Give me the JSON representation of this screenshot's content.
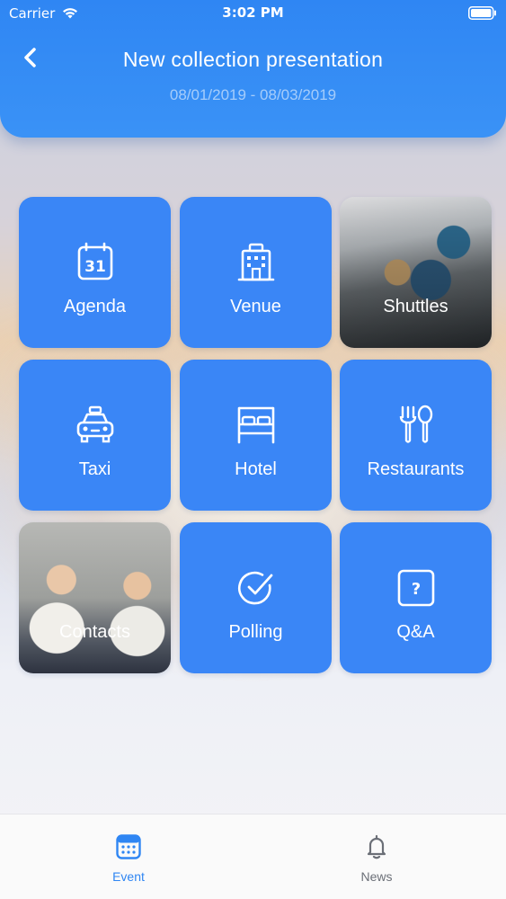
{
  "status_bar": {
    "carrier": "Carrier",
    "time": "3:02 PM"
  },
  "header": {
    "title": "New collection presentation",
    "dates": "08/01/2019 - 08/03/2019"
  },
  "calendar_day": "31",
  "qa_glyph": "?",
  "tiles": [
    {
      "label": "Agenda",
      "icon": "calendar-icon"
    },
    {
      "label": "Venue",
      "icon": "building-icon"
    },
    {
      "label": "Shuttles",
      "icon": "bus-interior-photo"
    },
    {
      "label": "Taxi",
      "icon": "taxi-icon"
    },
    {
      "label": "Hotel",
      "icon": "bed-icon"
    },
    {
      "label": "Restaurants",
      "icon": "fork-spoon-icon"
    },
    {
      "label": "Contacts",
      "icon": "children-photo"
    },
    {
      "label": "Polling",
      "icon": "check-circle-icon"
    },
    {
      "label": "Q&A",
      "icon": "question-icon"
    }
  ],
  "tabbar": {
    "event_label": "Event",
    "news_label": "News"
  },
  "colors": {
    "accent": "#2f86f3",
    "tile": "#3a86f6",
    "inactive_tab": "#6b6f77"
  }
}
